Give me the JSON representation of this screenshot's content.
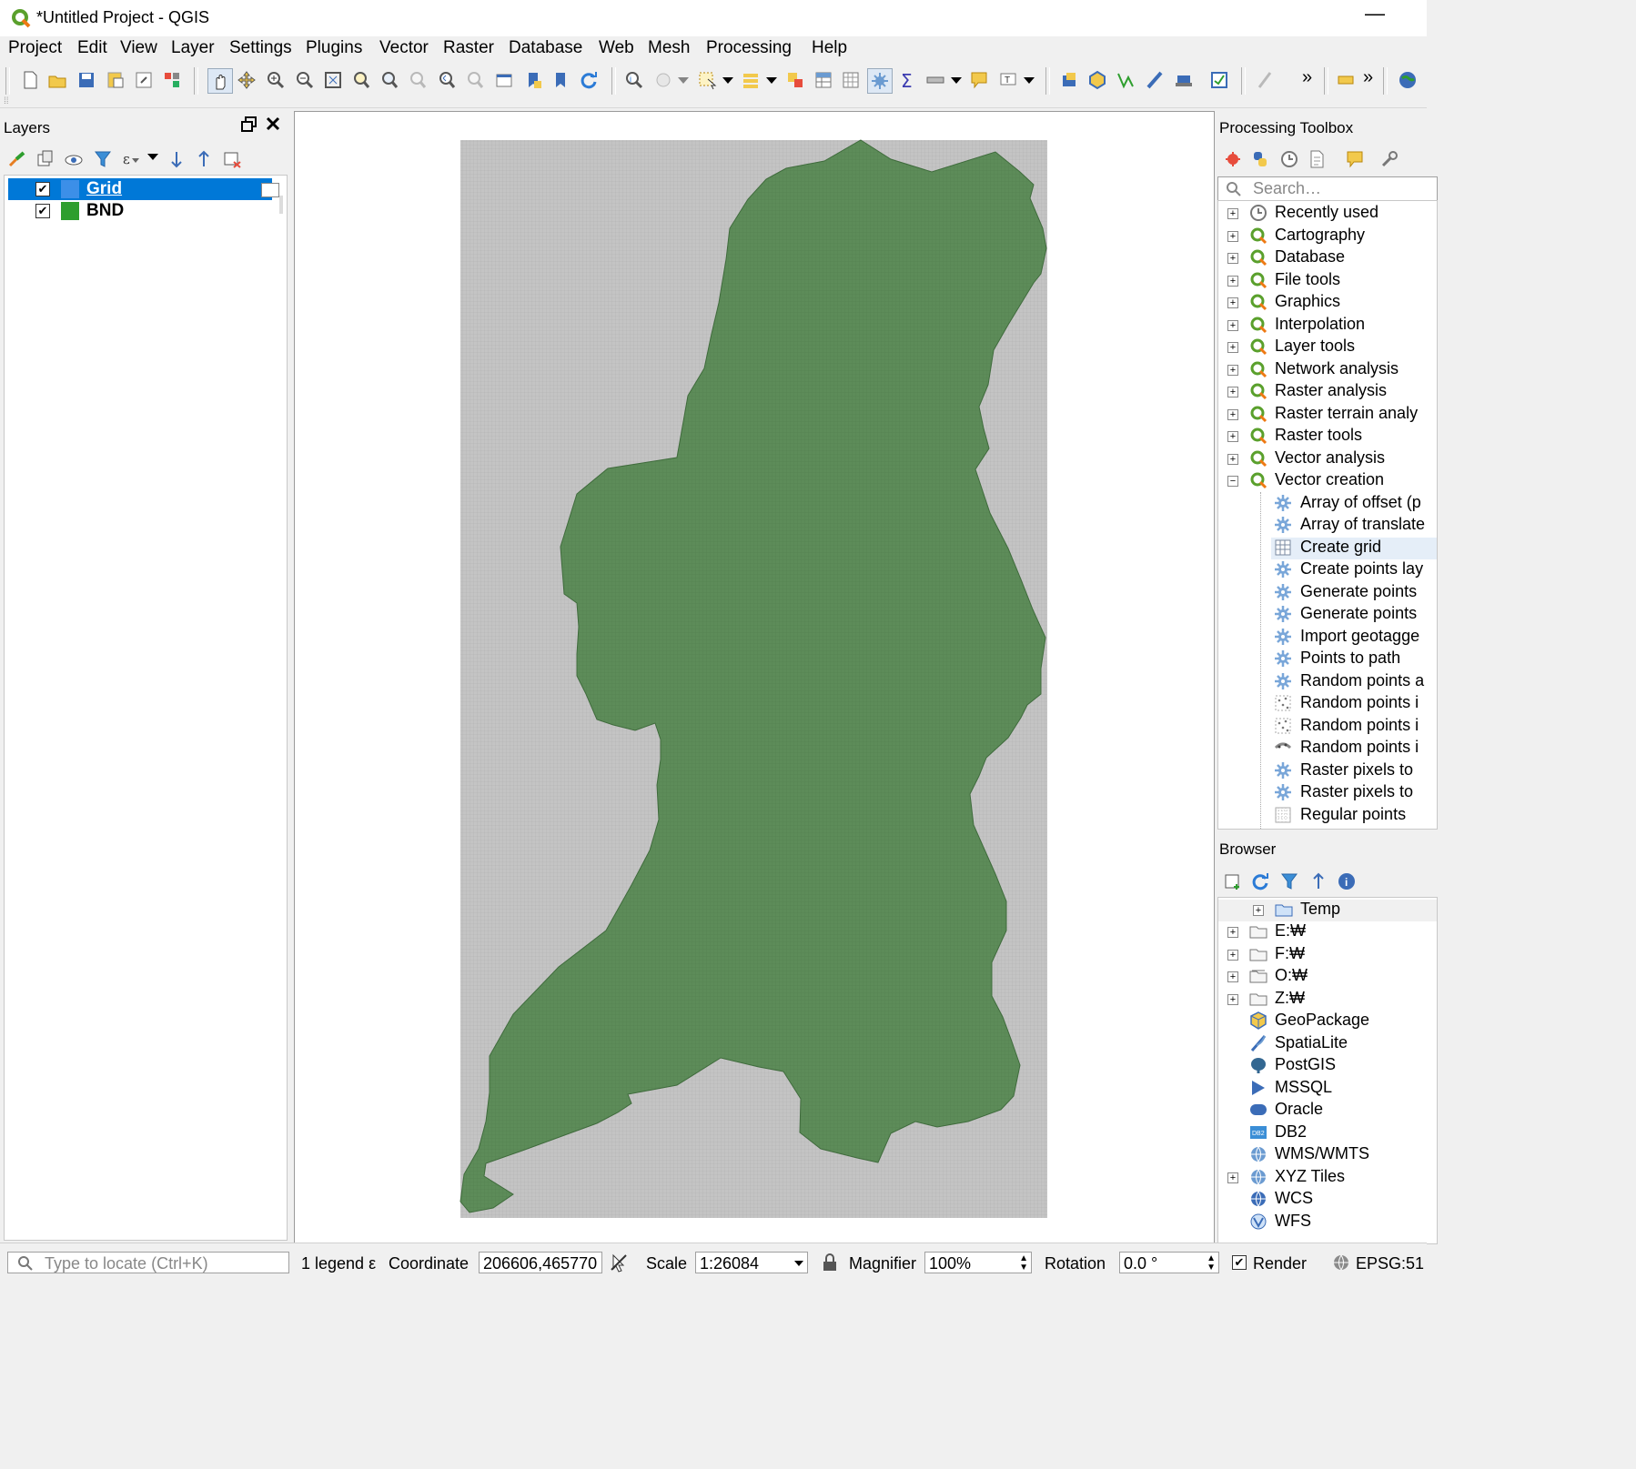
{
  "window": {
    "title": "*Untitled Project - QGIS",
    "minimize": "—"
  },
  "menu": [
    "Project",
    "Edit",
    "View",
    "Layer",
    "Settings",
    "Plugins",
    "Vector",
    "Raster",
    "Database",
    "Web",
    "Mesh",
    "Processing",
    "Help"
  ],
  "toolbar": {
    "overflow1": "»",
    "overflow2": "»"
  },
  "layers_panel": {
    "title": "Layers",
    "layers": [
      {
        "name": "Grid",
        "checked": "✔",
        "color": "#3c8fe8",
        "selected": true
      },
      {
        "name": "BND",
        "checked": "✔",
        "color": "#2e9e2e",
        "selected": false
      }
    ]
  },
  "map": {
    "background_color": "#c8c8c8",
    "polygon_color": "#5a8a56"
  },
  "processing_toolbox": {
    "title": "Processing Toolbox",
    "search_placeholder": "Search…",
    "groups": [
      "Recently used",
      "Cartography",
      "Database",
      "File tools",
      "Graphics",
      "Interpolation",
      "Layer tools",
      "Network analysis",
      "Raster analysis",
      "Raster terrain analy",
      "Raster tools",
      "Vector analysis",
      "Vector creation"
    ],
    "vector_creation_items": [
      "Array of offset (p",
      "Array of translate",
      "Create grid",
      "Create points lay",
      "Generate points",
      "Generate points",
      "Import geotagge",
      "Points to path",
      "Random points a",
      "Random points i",
      "Random points i",
      "Random points i",
      "Raster pixels to",
      "Raster pixels to",
      "Regular points"
    ]
  },
  "browser": {
    "title": "Browser",
    "items": [
      "Temp",
      "E:₩",
      "F:₩",
      "O:₩",
      "Z:₩",
      "GeoPackage",
      "SpatiaLite",
      "PostGIS",
      "MSSQL",
      "Oracle",
      "DB2",
      "WMS/WMTS",
      "XYZ Tiles",
      "WCS",
      "WFS"
    ]
  },
  "statusbar": {
    "locate_placeholder": "Type to locate (Ctrl+K)",
    "legend_text": "1 legend ε",
    "coordinate_label": "Coordinate",
    "coordinate_value": "206606,465770",
    "scale_label": "Scale",
    "scale_value": "1:26084",
    "magnifier_label": "Magnifier",
    "magnifier_value": "100%",
    "rotation_label": "Rotation",
    "rotation_value": "0.0 °",
    "render_label": "Render",
    "crs": "EPSG:51"
  }
}
